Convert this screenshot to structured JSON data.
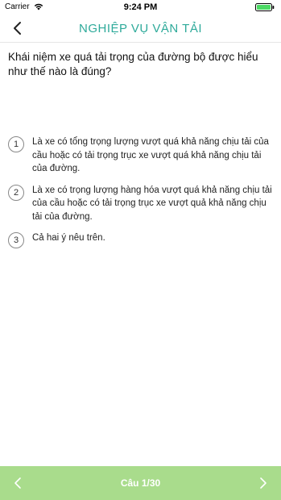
{
  "status_bar": {
    "carrier": "Carrier",
    "time": "9:24 PM"
  },
  "nav": {
    "title": "NGHIỆP VỤ VẬN TẢI",
    "back_icon": "chevron-left-icon"
  },
  "question": {
    "text": "Khái niệm xe quá tải trọng của đường bộ được hiểu như thế nào là đúng?"
  },
  "answers": [
    {
      "number": "1",
      "text": "Là xe có tổng trọng lượng vượt quá khả năng chịu tải của cầu hoặc có tải trọng trục xe vượt quá khả năng chịu tải của đường."
    },
    {
      "number": "2",
      "text": "Là xe có trọng lượng hàng hóa vượt quá khả năng chịu tải của cầu hoặc có tải trọng trục xe vượt quả khả năng chịu tải của đường."
    },
    {
      "number": "3",
      "text": "Cả hai ý nêu trên."
    }
  ],
  "footer": {
    "counter": "Câu 1/30",
    "prev_icon": "chevron-left-icon",
    "next_icon": "chevron-right-icon",
    "background": "#a9dc8c"
  },
  "colors": {
    "accent": "#2eaa9a"
  }
}
